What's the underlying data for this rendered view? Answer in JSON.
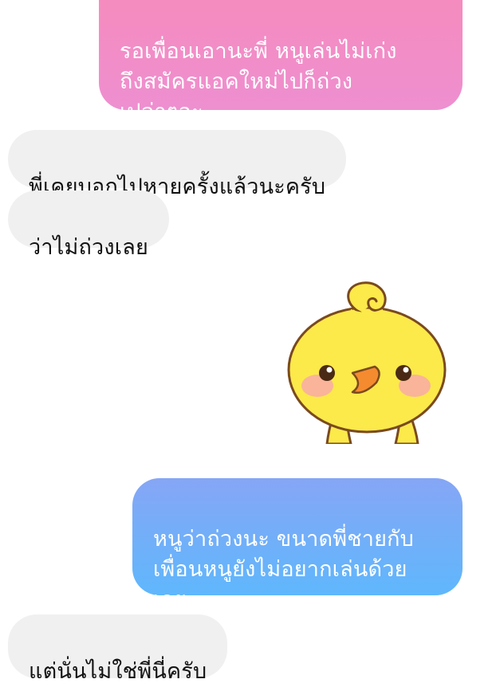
{
  "messages": [
    {
      "direction": "outgoing",
      "text": "รอเพื่อนเอานะพี่ หนูเล่นไม่เก่ง\nถึงสมัครแอคใหม่ไปก็ถ่วง\nเปล่าๆอะ"
    },
    {
      "direction": "incoming",
      "text": "พี่เคยบอกไปหายครั้งแล้วนะครับ"
    },
    {
      "direction": "incoming",
      "text": "ว่าไม่ถ่วงเลย"
    },
    {
      "direction": "outgoing",
      "type": "sticker",
      "sticker": "yellow-chick-sticker"
    },
    {
      "direction": "outgoing",
      "text": "หนูว่าถ่วงนะ ขนาดพี่ชายกับ\nเพื่อนหนูยังไม่อยากเล่นด้วย\nเลย"
    },
    {
      "direction": "incoming",
      "text": "แต่นั่นไม่ใช่พี่นี่ครับ"
    }
  ],
  "colors": {
    "outgoing_pink_top": "#f68bbd",
    "outgoing_pink_bottom": "#ee8fd0",
    "outgoing_blue_top": "#86a6f5",
    "outgoing_blue_bottom": "#5fb7fc",
    "incoming_bubble": "#f0f0f0",
    "chick_body": "#fce94a",
    "chick_beak": "#f58b2f",
    "chick_cheek": "#f9b49a"
  }
}
